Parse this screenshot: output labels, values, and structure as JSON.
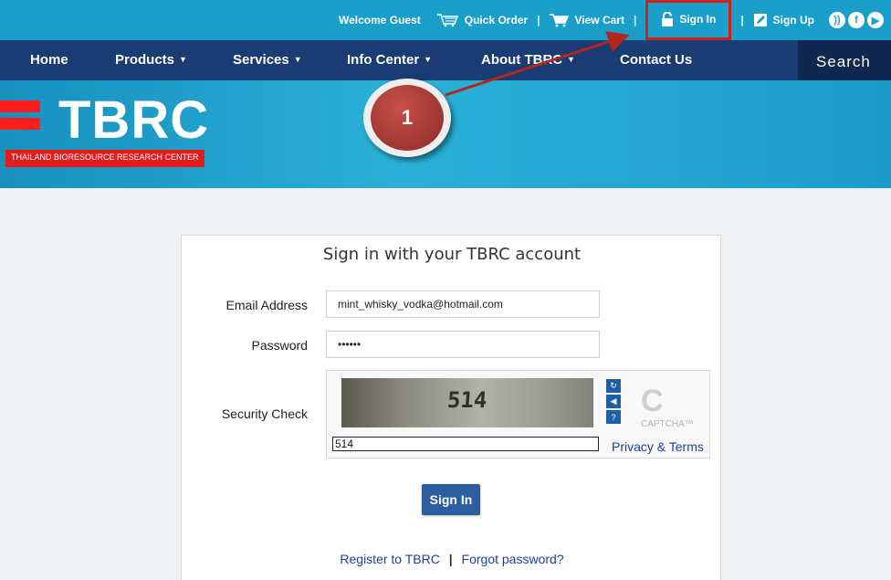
{
  "topbar": {
    "welcome": "Welcome Guest",
    "quick_order": "Quick Order",
    "view_cart": "View Cart",
    "sign_in": "Sign In",
    "sign_up": "Sign Up",
    "separator": "|"
  },
  "nav": {
    "items": [
      {
        "label": "Home",
        "caret": ""
      },
      {
        "label": "Products",
        "caret": "▼"
      },
      {
        "label": "Services",
        "caret": "▼"
      },
      {
        "label": "Info Center",
        "caret": "▼"
      },
      {
        "label": "About TBRC",
        "caret": "▼"
      },
      {
        "label": "Contact Us",
        "caret": ""
      }
    ],
    "search_label": "Search"
  },
  "banner": {
    "logo_text": "TBRC",
    "logo_subtitle": "THAILAND BIORESOURCE RESEARCH CENTER"
  },
  "annotation": {
    "number": "1"
  },
  "form": {
    "title": "Sign in with your TBRC account",
    "email_label": "Email Address",
    "email_value": "mint_whisky_vodka@hotmail.com",
    "password_label": "Password",
    "password_value": "••••••",
    "security_label": "Security Check",
    "captcha_code": "514",
    "captcha_input": "514",
    "captcha_brand": "CAPTCHA™",
    "privacy_link": "Privacy & Terms",
    "submit_label": "Sign In",
    "register_link": "Register to TBRC",
    "forgot_link": "Forgot password?",
    "link_separator": "|"
  },
  "colors": {
    "topbar": "#1a9fcb",
    "navbar": "#183c73",
    "accent_red": "#d0201c",
    "button": "#2b5da0",
    "link": "#1a3fa0"
  }
}
